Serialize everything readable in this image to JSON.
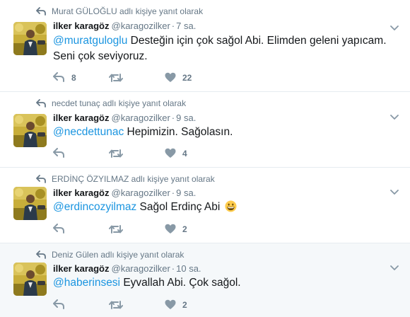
{
  "colors": {
    "mention": "#1b95e0",
    "muted": "#657786",
    "divider": "#e6ecf0",
    "shaded_row": "#f5f8fa"
  },
  "tweets": [
    {
      "context": "Murat GÜLOĞLU adlı kişiye yanıt olarak",
      "name": "ilker karagöz",
      "handle": "@karagozilker",
      "separator": "·",
      "time": "7 sa.",
      "mention": "@muratguloglu",
      "text": " Desteğin için çok sağol Abi. Elimden geleni yapıcam. Seni çok seviyoruz.",
      "reply_count": "8",
      "retweet_count": "",
      "like_count": "22"
    },
    {
      "context": "necdet tunaç adlı kişiye yanıt olarak",
      "name": "ilker karagöz",
      "handle": "@karagozilker",
      "separator": "·",
      "time": "9 sa.",
      "mention": "@necdettunac",
      "text": " Hepimizin. Sağolasın.",
      "reply_count": "",
      "retweet_count": "",
      "like_count": "4"
    },
    {
      "context": "ERDİNÇ ÖZYILMAZ adlı kişiye yanıt olarak",
      "name": "ilker karagöz",
      "handle": "@karagozilker",
      "separator": "·",
      "time": "9 sa.",
      "mention": "@erdincozyilmaz",
      "text": " Sağol Erdinç Abi ",
      "emoji": "grinning-face",
      "reply_count": "",
      "retweet_count": "",
      "like_count": "2"
    },
    {
      "context": "Deniz Gülen adlı kişiye yanıt olarak",
      "name": "ilker karagöz",
      "handle": "@karagozilker",
      "separator": "·",
      "time": "10 sa.",
      "mention": "@haberinsesi",
      "text": " Eyvallah Abi. Çok sağol.",
      "reply_count": "",
      "retweet_count": "",
      "like_count": "2"
    }
  ]
}
